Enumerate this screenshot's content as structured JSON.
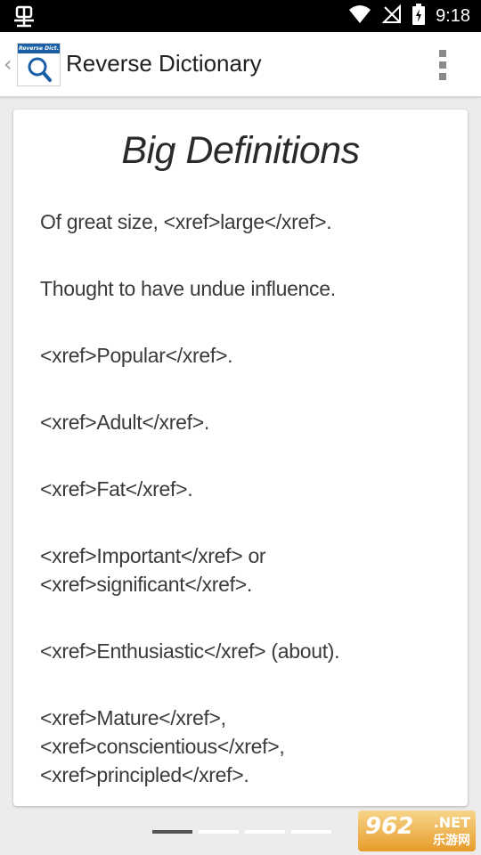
{
  "status_bar": {
    "time": "9:18",
    "icons": [
      "debug-icon",
      "wifi-icon",
      "signal-off-icon",
      "battery-charging-icon"
    ]
  },
  "app_bar": {
    "title": "Reverse Dictionary",
    "logo_text": "Reverse Dict.",
    "icons": [
      "back-chevron-icon",
      "magnifier-icon",
      "overflow-menu-icon"
    ]
  },
  "card": {
    "title": "Big Definitions",
    "definitions": [
      "Of great size, <xref>large</xref>.",
      "Thought to have undue influence.",
      "<xref>Popular</xref>.",
      "<xref>Adult</xref>.",
      "<xref>Fat</xref>.",
      "<xref>Important</xref> or <xref>significant</xref>.",
      "<xref>Enthusiastic</xref> (about).",
      "<xref>Mature</xref>, <xref>conscientious</xref>, <xref>principled</xref>."
    ]
  },
  "pager": {
    "page_count": 4,
    "current_page": 1
  },
  "watermark": {
    "number": "962",
    "suffix": ".NET",
    "cn_text": "乐游网"
  },
  "colors": {
    "accent_blue": "#1a5fa6",
    "status_bar": "#000000",
    "background": "#ececec"
  }
}
